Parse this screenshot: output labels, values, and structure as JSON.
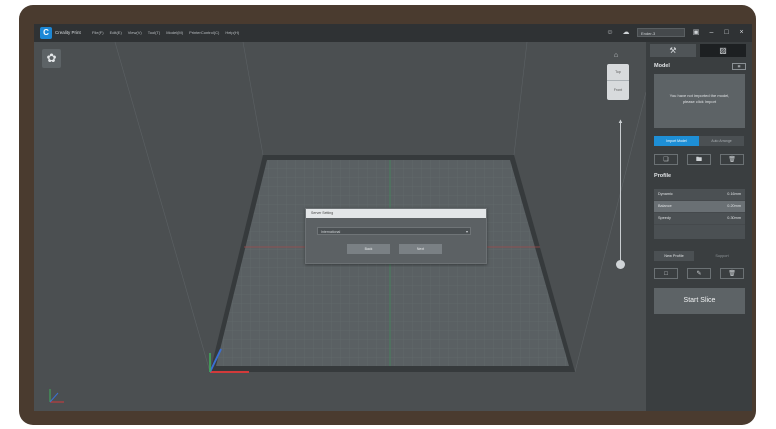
{
  "app": {
    "name": "Creality Print",
    "logo": "C",
    "menus": [
      "File(F)",
      "Edit(E)",
      "View(V)",
      "Tool(T)",
      "Model(M)",
      "PrinterControl(C)",
      "Help(H)"
    ]
  },
  "topbar": {
    "user_icon": "user-icon",
    "cloud_icon": "cloud-icon",
    "printer_name": "Ender-3"
  },
  "dialog": {
    "title": "Server Setting",
    "select_value": "International",
    "back_label": "Back",
    "next_label": "Next"
  },
  "view_cube": {
    "top_label": "Top",
    "front_label": "Front"
  },
  "panel": {
    "model_title": "Model",
    "model_message_line1": "You have not imported the model,",
    "model_message_line2": "please click Import",
    "import_label": "Import Model",
    "auto_label": "Auto Arrange",
    "profile_title": "Profile",
    "profiles": [
      {
        "name": "Dynamic",
        "value": "0.16mm"
      },
      {
        "name": "Balance",
        "value": "0.20mm"
      },
      {
        "name": "Speedy",
        "value": "0.30mm"
      }
    ],
    "new_profile_label": "New Profile",
    "support_label": "Support",
    "start_slice_label": "Start Slice"
  },
  "colors": {
    "accent": "#1e8fd6",
    "axis_red": "#d23a3a",
    "axis_green": "#3fae5a",
    "axis_blue": "#3a6fd2"
  }
}
